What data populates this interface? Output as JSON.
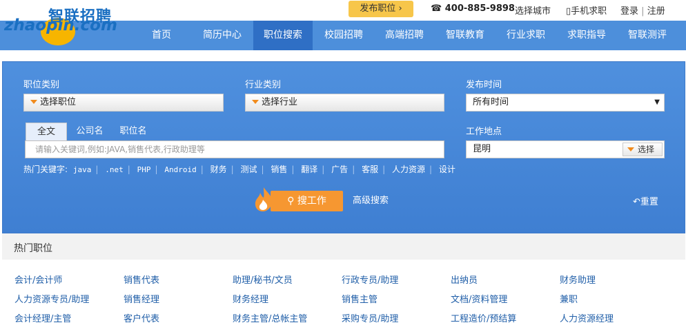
{
  "header": {
    "logo_cn": "智联招聘",
    "logo_en": "zhaopin.com",
    "post_job": "发布职位",
    "phone": "400-885-9898",
    "city": "选择城市",
    "mobile": "手机求职",
    "login": "登录",
    "register": "注册"
  },
  "nav": [
    "首页",
    "简历中心",
    "职位搜索",
    "校园招聘",
    "高端招聘",
    "智联教育",
    "行业求职",
    "求职指导",
    "智联测评"
  ],
  "search": {
    "job_category_label": "职位类别",
    "job_category_value": "选择职位",
    "industry_label": "行业类别",
    "industry_value": "选择行业",
    "time_label": "发布时间",
    "time_value": "所有时间",
    "tabs": [
      "全文",
      "公司名",
      "职位名"
    ],
    "keyword_placeholder": "请输入关键词,例如:JAVA,销售代表,行政助理等",
    "location_label": "工作地点",
    "location_value": "昆明",
    "location_button": "选择",
    "hot_label": "热门关键字:",
    "hot_keywords": [
      "java",
      ".net",
      "PHP",
      "Android",
      "财务",
      "测试",
      "销售",
      "翻译",
      "广告",
      "客服",
      "人力资源",
      "设计"
    ],
    "search_button": "搜工作",
    "advanced": "高级搜索",
    "reset": "重置"
  },
  "hot_jobs": {
    "title": "热门职位",
    "rows": [
      [
        "会计/会计师",
        "销售代表",
        "助理/秘书/文员",
        "行政专员/助理",
        "出纳员",
        "财务助理"
      ],
      [
        "人力资源专员/助理",
        "销售经理",
        "财务经理",
        "销售主管",
        "文档/资料管理",
        "兼职"
      ],
      [
        "会计经理/主管",
        "客户代表",
        "财务主管/总帐主管",
        "采购专员/助理",
        "工程造价/预结算",
        "人力资源经理"
      ]
    ]
  },
  "colors": {
    "nav": "#4d8fdb",
    "nav_active": "#2f6fc5",
    "accent": "#f69731",
    "link": "#1f5ea8"
  }
}
